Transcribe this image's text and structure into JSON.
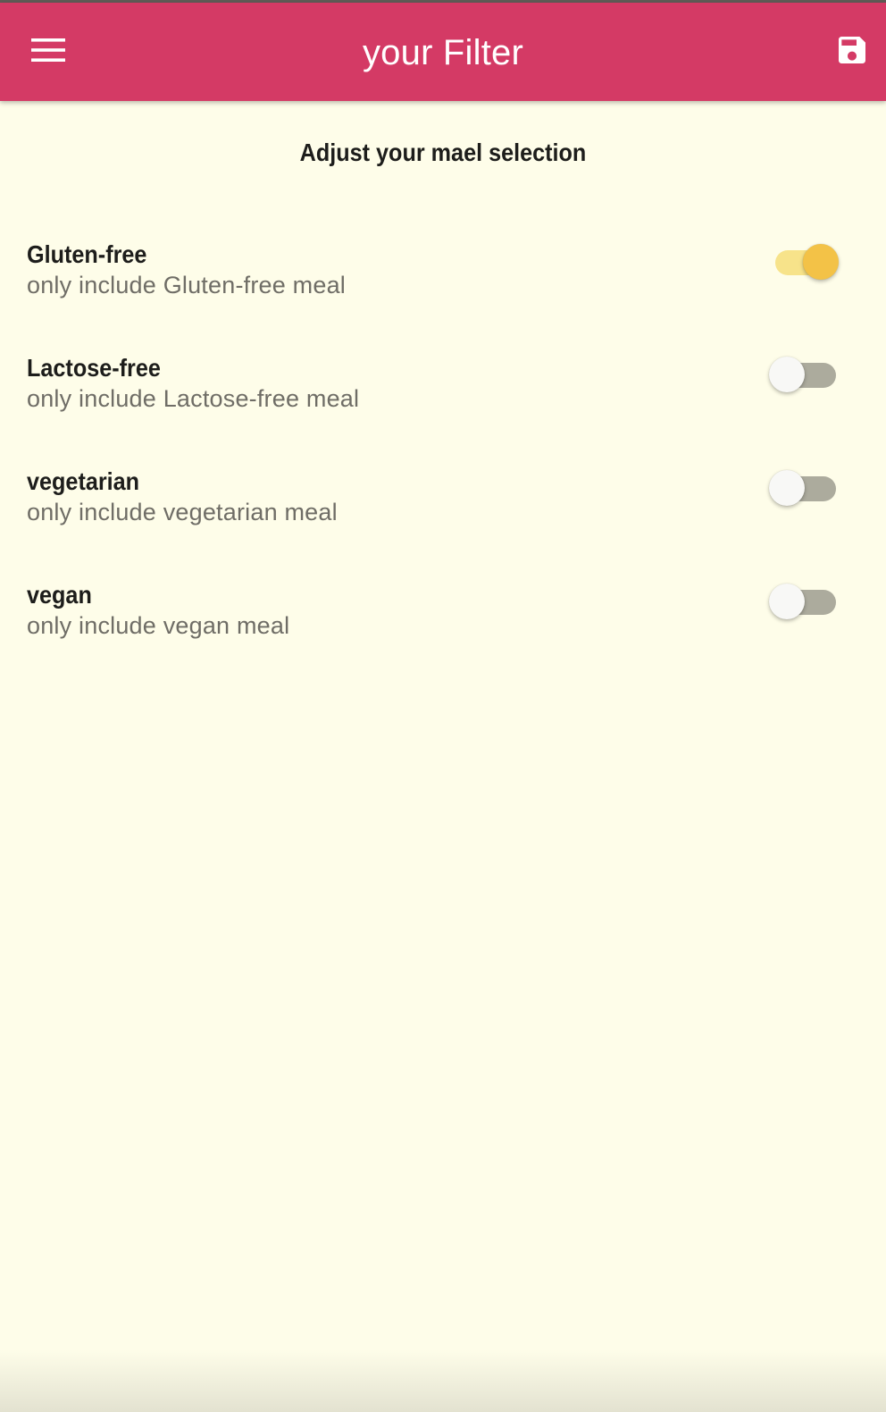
{
  "app_bar": {
    "title": "your Filter",
    "background_color": "#d43a65",
    "menu_icon": "menu-icon",
    "save_icon": "save-icon"
  },
  "main": {
    "heading": "Adjust your mael selection",
    "background_color": "#fefde9",
    "filters": [
      {
        "title": "Gluten-free",
        "subtitle": "only include Gluten-free meal",
        "enabled": true
      },
      {
        "title": "Lactose-free",
        "subtitle": "only include Lactose-free meal",
        "enabled": false
      },
      {
        "title": "vegetarian",
        "subtitle": "only include vegetarian meal",
        "enabled": false
      },
      {
        "title": "vegan",
        "subtitle": "only include vegan meal",
        "enabled": false
      }
    ]
  },
  "colors": {
    "switch_on_thumb": "#f3c247",
    "switch_on_track": "#f7e38a",
    "switch_off_thumb": "#f8f8f6",
    "switch_off_track": "#acab9d"
  }
}
